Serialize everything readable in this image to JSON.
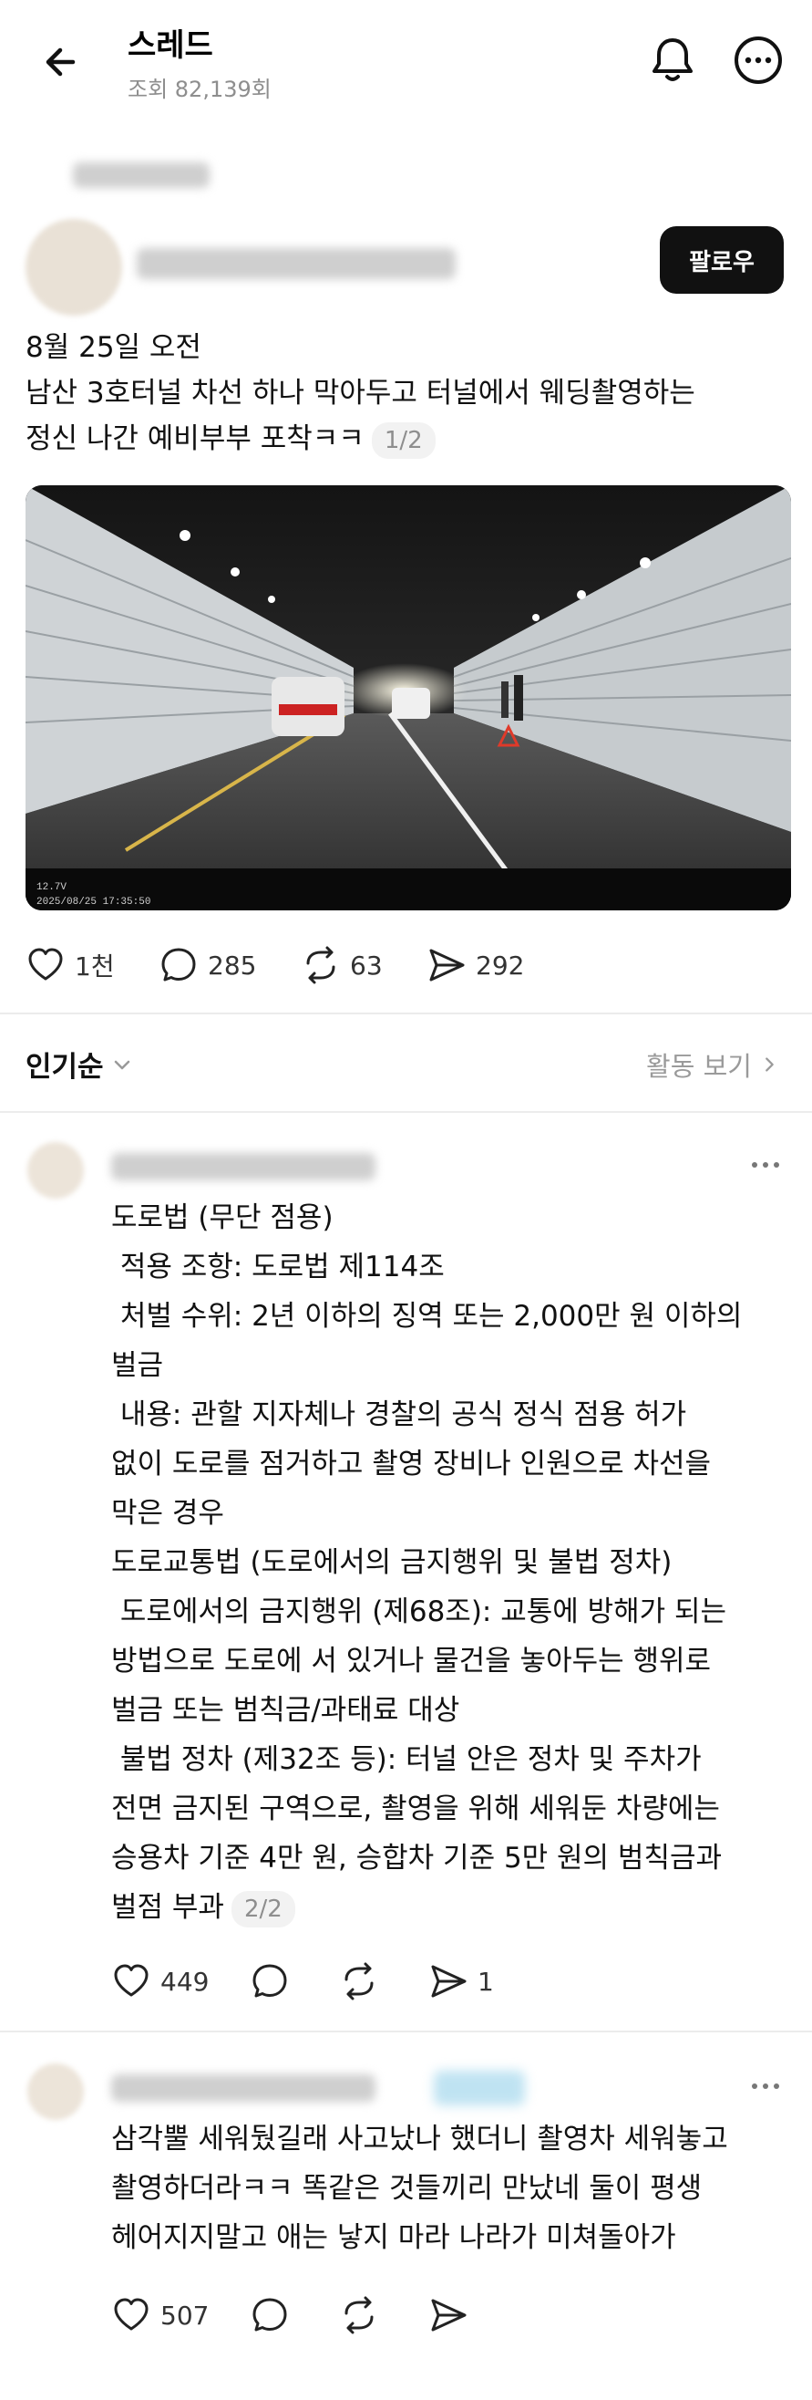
{
  "header": {
    "title": "스레드",
    "views": "조회 82,139회"
  },
  "post": {
    "follow_label": "팔로우",
    "lines": [
      "8월 25일 오전",
      "남산 3호터널 차선 하나 막아두고 터널에서 웨딩촬영하는",
      "정신 나간 예비부부 포착ㅋㅋ"
    ],
    "pager": "1/2",
    "stats": {
      "likes": "1천",
      "comments": "285",
      "reposts": "63",
      "shares": "292"
    }
  },
  "sort": {
    "label": "인기순",
    "activity_label": "활동 보기"
  },
  "comments": [
    {
      "lines": [
        "도로법 (무단 점용)",
        " 적용 조항: 도로법 제114조",
        " 처벌 수위: 2년 이하의 징역 또는 2,000만 원 이하의",
        "벌금",
        " 내용: 관할 지자체나 경찰의 공식 정식 점용 허가",
        "없이 도로를 점거하고 촬영 장비나 인원으로 차선을",
        "막은 경우",
        "도로교통법 (도로에서의 금지행위 및 불법 정차)",
        " 도로에서의 금지행위 (제68조): 교통에 방해가 되는",
        "방법으로 도로에 서 있거나 물건을 놓아두는 행위로",
        "벌금 또는 범칙금/과태료 대상",
        " 불법 정차 (제32조 등): 터널 안은 정차 및 주차가",
        "전면 금지된 구역으로, 촬영을 위해 세워둔 차량에는",
        "승용차 기준 4만 원, 승합차 기준 5만 원의 범칙금과",
        "벌점 부과"
      ],
      "pager": "2/2",
      "likes": "449",
      "shares": "1"
    },
    {
      "lines": [
        "삼각뿔 세워뒀길래 사고났나 했더니 촬영차 세워놓고",
        "촬영하더라ㅋㅋ 똑같은 것들끼리 만났네 둘이 평생",
        "헤어지지말고 애는 낳지 마라 나라가 미쳐돌아가"
      ],
      "likes": "507"
    }
  ],
  "video_overlay": {
    "line1": "12.7V",
    "line2": "2025/08/25 17:35:50"
  },
  "colors": {
    "text": "#111111",
    "muted": "#8e8e8e",
    "follow_bg": "#111111",
    "divider": "#ececec"
  }
}
